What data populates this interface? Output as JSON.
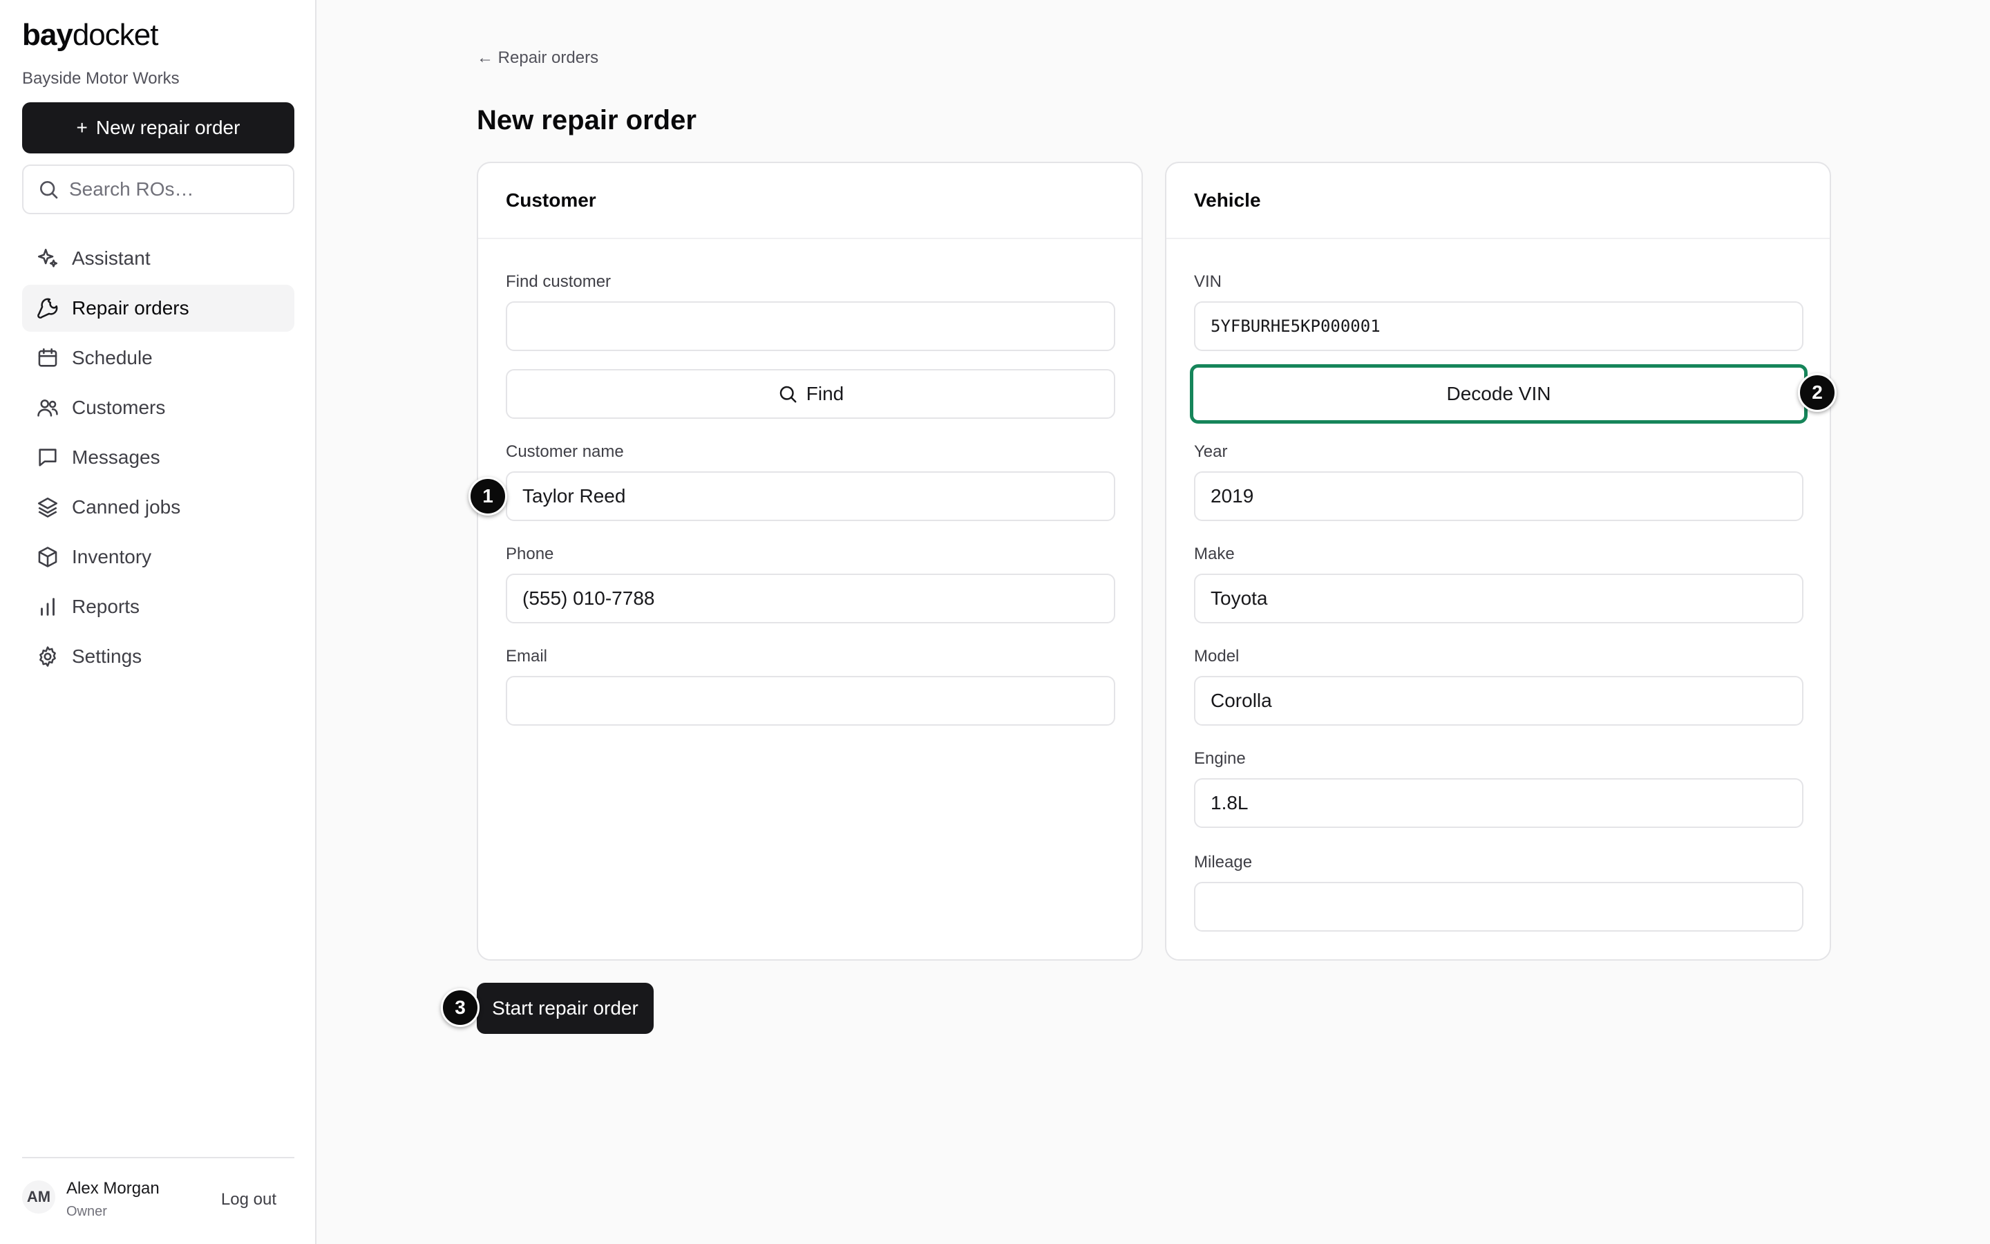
{
  "sidebar": {
    "brand_bold": "bay",
    "brand_light": "docket",
    "shop_name": "Bayside Motor Works",
    "new_ro_label": "New repair order",
    "new_ro_plus": "+",
    "search_placeholder": "Search ROs…",
    "nav": [
      {
        "label": "Assistant",
        "icon": "sparkles-icon"
      },
      {
        "label": "Repair orders",
        "icon": "wrench-icon",
        "active": true
      },
      {
        "label": "Schedule",
        "icon": "calendar-icon"
      },
      {
        "label": "Customers",
        "icon": "users-icon"
      },
      {
        "label": "Messages",
        "icon": "message-icon"
      },
      {
        "label": "Canned jobs",
        "icon": "layers-icon"
      },
      {
        "label": "Inventory",
        "icon": "box-icon"
      },
      {
        "label": "Reports",
        "icon": "bar-chart-icon"
      },
      {
        "label": "Settings",
        "icon": "gear-icon"
      }
    ],
    "user": {
      "initials": "AM",
      "name": "Alex Morgan",
      "role": "Owner",
      "logout_label": "Log out"
    }
  },
  "main": {
    "back_link": "← Repair orders",
    "page_title": "New repair order",
    "customer": {
      "title": "Customer",
      "find_label": "Find customer",
      "find_value": "",
      "find_button": "Find",
      "name_label": "Customer name",
      "name_value": "Taylor Reed",
      "phone_label": "Phone",
      "phone_value": "(555) 010-7788",
      "email_label": "Email",
      "email_value": ""
    },
    "vehicle": {
      "title": "Vehicle",
      "vin_label": "VIN",
      "vin_value": "5YFBURHE5KP000001",
      "decode_button": "Decode VIN",
      "year_label": "Year",
      "year_value": "2019",
      "make_label": "Make",
      "make_value": "Toyota",
      "model_label": "Model",
      "model_value": "Corolla",
      "engine_label": "Engine",
      "engine_value": "1.8L",
      "mileage_label": "Mileage",
      "mileage_value": ""
    },
    "start_button": "Start repair order"
  },
  "markers": [
    "1",
    "2",
    "3"
  ],
  "colors": {
    "primary": "#18181b",
    "highlight": "#16855a",
    "background": "#fafafa"
  }
}
